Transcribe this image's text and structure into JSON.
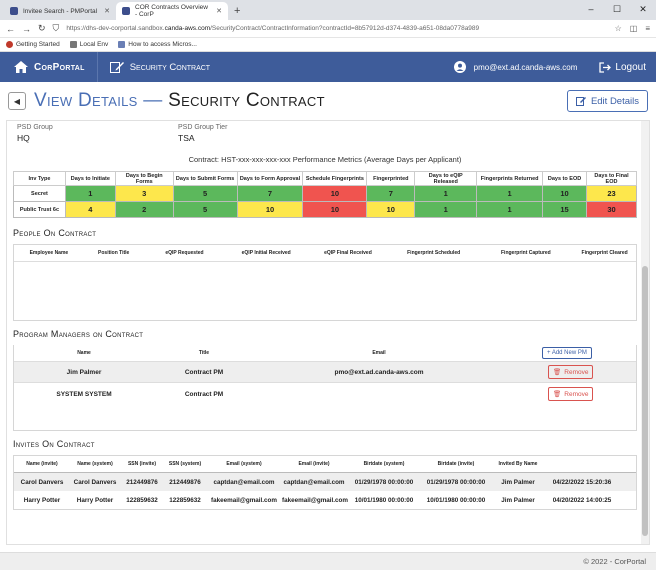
{
  "browser": {
    "tabs": [
      {
        "label": "Invitee Search - PMPortal",
        "active": false
      },
      {
        "label": "COR Contracts Overview - CorP",
        "active": true
      }
    ],
    "url_prefix": "https://dhs-dev-corportal.sandbox.",
    "url_domain": "canda-aws.com",
    "url_path": "/SecurityContract/ContractInformation?contractId=8b57912d-d374-4839-a651-08da0778a989",
    "bookmarks": [
      "Getting Started",
      "Local Env",
      "How to access Micros..."
    ]
  },
  "nav": {
    "brand": "CorPortal",
    "link": "Security Contract",
    "user_email": "pmo@ext.ad.canda-aws.com",
    "logout": "Logout",
    "color": "#3e5c9a"
  },
  "header": {
    "title_part1": "View Details",
    "title_sep": "—",
    "title_part2": "Security Contract",
    "edit_label": "Edit Details"
  },
  "psd": {
    "group_label": "PSD Group",
    "group_value": "HQ",
    "tier_label": "PSD Group Tier",
    "tier_value": "TSA"
  },
  "metrics": {
    "title": "Contract: HST-xxx-xxx-xxx-xxx Performance Metrics (Average Days per Applicant)",
    "columns": [
      "Inv Type",
      "Days to Initiate",
      "Days to Begin Forms",
      "Days to Submit Forms",
      "Days to Form Approval",
      "Schedule Fingerprints",
      "Fingerprinted",
      "Days to eQIP Released",
      "Fingerprints Returned",
      "Days to EOD",
      "Days to Final EOD"
    ],
    "rows": [
      {
        "label": "Secret",
        "values": [
          "1",
          "3",
          "5",
          "7",
          "10",
          "7",
          "1",
          "1",
          "10",
          "23"
        ],
        "colors": [
          "green",
          "yellow",
          "green",
          "green",
          "red",
          "green",
          "green",
          "green",
          "green",
          "yellow"
        ]
      },
      {
        "label": "Public Trust 6c",
        "values": [
          "4",
          "2",
          "5",
          "10",
          "10",
          "10",
          "1",
          "1",
          "15",
          "30"
        ],
        "colors": [
          "yellow",
          "green",
          "green",
          "yellow",
          "red",
          "yellow",
          "green",
          "green",
          "green",
          "red"
        ]
      }
    ],
    "palette": {
      "green": "#5cb85c",
      "yellow": "#fde74c",
      "red": "#f0544f"
    }
  },
  "people": {
    "title": "People On Contract",
    "columns": [
      "Employee Name",
      "Position Title",
      "eQIP Requested",
      "eQIP Initial Received",
      "eQIP Final Received",
      "Fingerprint Scheduled",
      "Fingerprint Captured",
      "Fingerprint Cleared"
    ]
  },
  "pms": {
    "title": "Program Managers on Contract",
    "columns": [
      "Name",
      "Title",
      "Email"
    ],
    "add_label": "+ Add New PM",
    "remove_label": "Remove",
    "rows": [
      {
        "name": "Jim Palmer",
        "title": "Contract PM",
        "email": "pmo@ext.ad.canda-aws.com"
      },
      {
        "name": "SYSTEM SYSTEM",
        "title": "Contract PM",
        "email": ""
      }
    ]
  },
  "invites": {
    "title": "Invites On Contract",
    "columns": [
      "Name (invite)",
      "Name (system)",
      "SSN (invite)",
      "SSN (system)",
      "Email (system)",
      "Email (invite)",
      "Birtdate (system)",
      "Birtdate (invite)",
      "Invited By Name",
      ""
    ],
    "rows": [
      [
        "Carol Danvers",
        "Carol Danvers",
        "212449876",
        "212449876",
        "captdan@email.com",
        "captdan@email.com",
        "01/29/1978 00:00:00",
        "01/29/1978 00:00:00",
        "Jim Palmer",
        "04/22/2022 15:20:36"
      ],
      [
        "Harry Potter",
        "Harry Potter",
        "122859632",
        "122859632",
        "fakeemail@gmail.com",
        "fakeemail@gmail.com",
        "10/01/1980 00:00:00",
        "10/01/1980 00:00:00",
        "Jim Palmer",
        "04/20/2022 14:00:25"
      ]
    ]
  },
  "footer": "© 2022 - CorPortal"
}
